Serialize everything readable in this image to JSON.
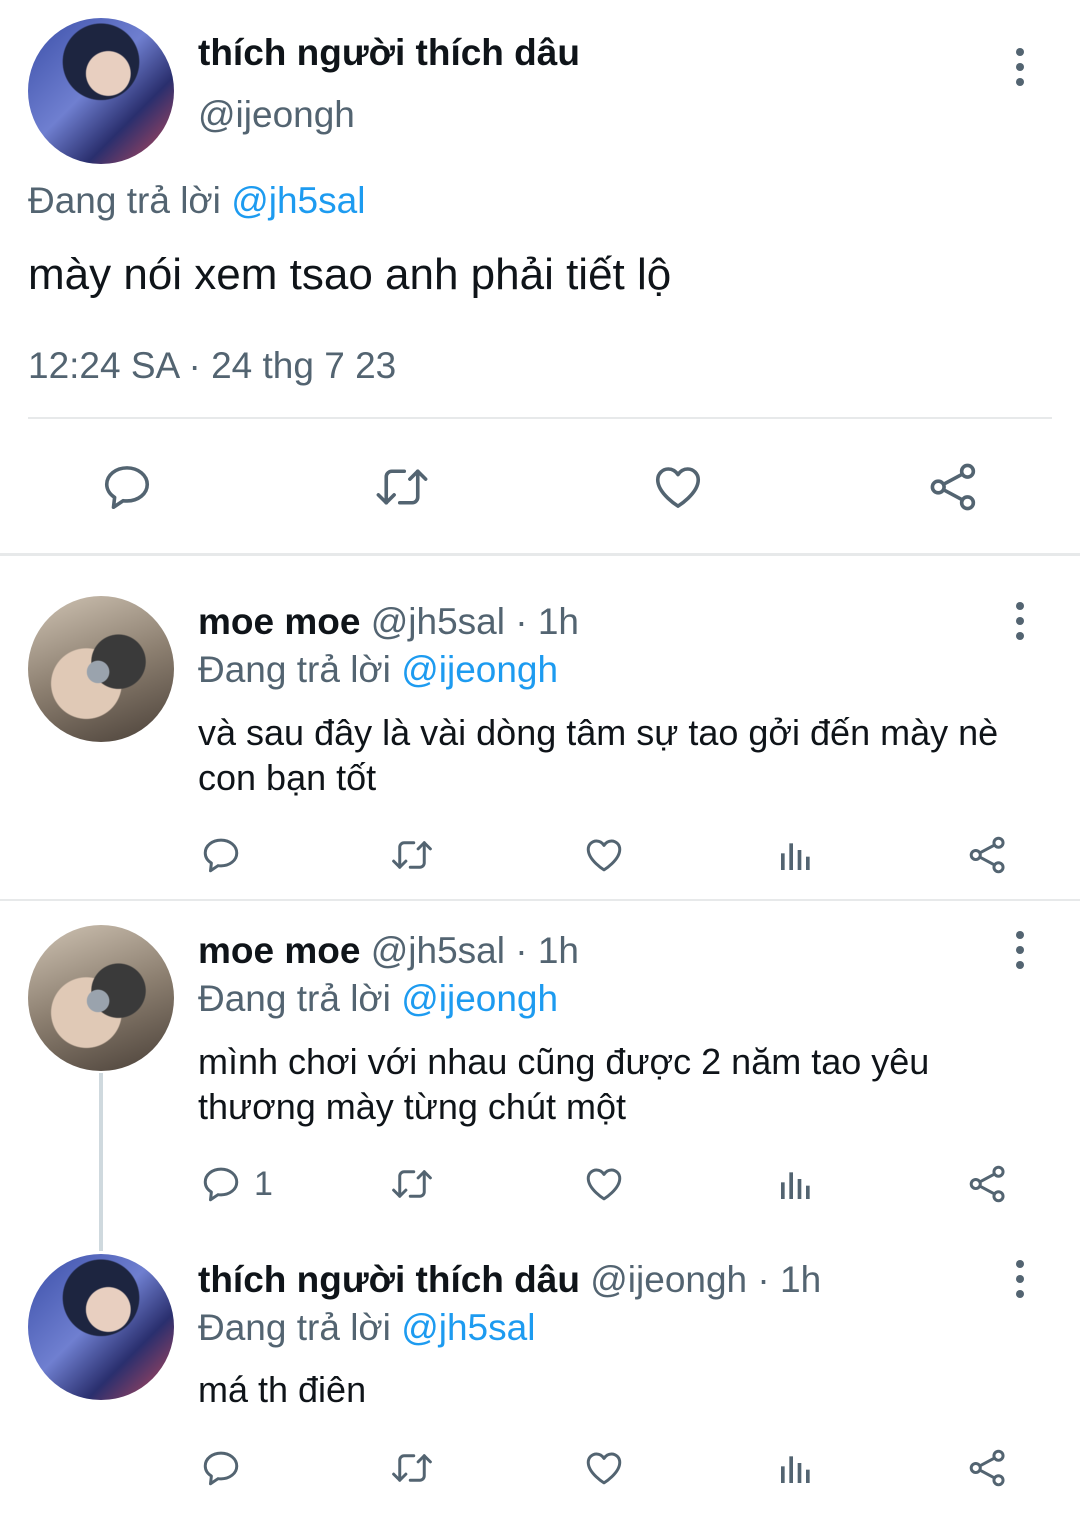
{
  "main_tweet": {
    "display_name": "thích người thích dâu",
    "handle": "@ijeongh",
    "reply_prefix": "Đang trả lời",
    "reply_to": "@jh5sal",
    "text": "mày nói xem tsao anh phải tiết lộ",
    "timestamp": "12:24 SA · 24 thg 7 23"
  },
  "replies": [
    {
      "display_name": "moe moe",
      "handle": "@jh5sal",
      "time": "· 1h",
      "reply_prefix": "Đang trả lời",
      "reply_to": "@ijeongh",
      "text": "và sau đây là vài dòng tâm sự tao gởi đến mày nè con bạn tốt",
      "reply_count": ""
    },
    {
      "display_name": "moe moe",
      "handle": "@jh5sal",
      "time": "· 1h",
      "reply_prefix": "Đang trả lời",
      "reply_to": "@ijeongh",
      "text": "mình chơi với nhau cũng được 2 năm tao yêu thương mày từng chút một",
      "reply_count": "1"
    },
    {
      "display_name": "thích người thích dâu",
      "handle": "@ijeongh",
      "time": "· 1h",
      "reply_prefix": "Đang trả lời",
      "reply_to": "@jh5sal",
      "text": "má th điên",
      "reply_count": ""
    }
  ],
  "colors": {
    "mention": "#1d9bf0",
    "secondary_text": "#536471",
    "divider": "#e7e9ea"
  },
  "icons": [
    "reply-icon",
    "retweet-icon",
    "like-icon",
    "analytics-icon",
    "share-icon",
    "more-icon"
  ]
}
